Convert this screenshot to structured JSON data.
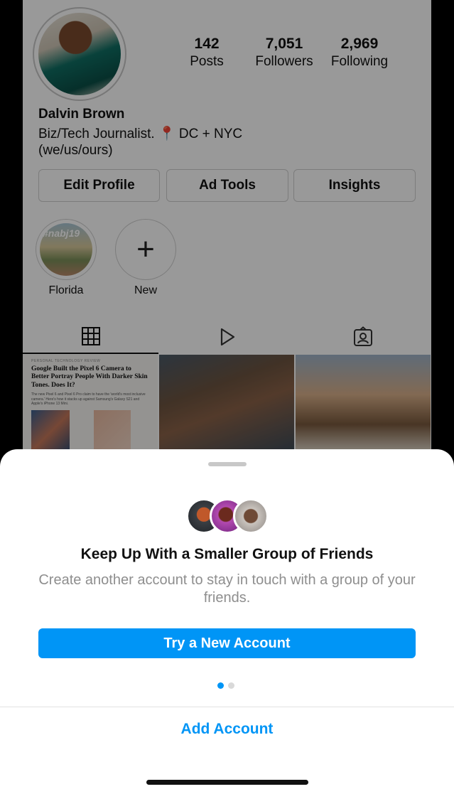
{
  "profile": {
    "name": "Dalvin Brown",
    "bio_line1": "Biz/Tech Journalist. 📍 DC + NYC",
    "bio_line2": "(we/us/ours)",
    "stats": [
      {
        "value": "142",
        "label": "Posts"
      },
      {
        "value": "7,051",
        "label": "Followers"
      },
      {
        "value": "2,969",
        "label": "Following"
      }
    ],
    "buttons": {
      "edit": "Edit Profile",
      "ad_tools": "Ad Tools",
      "insights": "Insights"
    },
    "highlights": [
      {
        "label": "Florida",
        "tag": "#nabj19"
      },
      {
        "label": "New",
        "icon": "plus-icon"
      }
    ],
    "tabs": [
      {
        "icon": "grid-icon",
        "active": true
      },
      {
        "icon": "reels-icon",
        "active": false
      },
      {
        "icon": "tagged-icon",
        "active": false
      }
    ],
    "posts": {
      "article_kicker": "PERSONAL TECHNOLOGY REVIEW",
      "article_headline": "Google Built the Pixel 6 Camera to Better Portray People With Darker Skin Tones. Does It?",
      "article_body": "The new Pixel 6 and Pixel 6 Pro claim to have the 'world's most inclusive camera.' Here's how it stacks up against Samsung's Galaxy S21 and Apple's iPhone 13 Mini."
    }
  },
  "sheet": {
    "title": "Keep Up With a Smaller Group of Friends",
    "subtitle": "Create another account to stay in touch with a group of your friends.",
    "primary_button": "Try a New Account",
    "secondary_button": "Add Account",
    "page_indicator": {
      "current": 1,
      "total": 2
    }
  },
  "colors": {
    "accent": "#0095f6",
    "overlay": "rgba(0,0,0,0.4)"
  }
}
